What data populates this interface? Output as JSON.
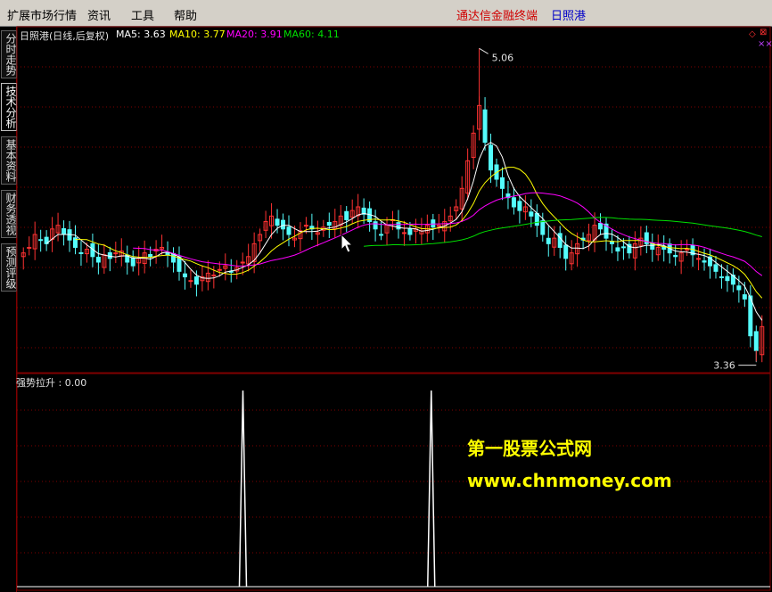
{
  "menu": {
    "items": [
      "扩展市场行情",
      "资讯",
      "工具",
      "帮助"
    ],
    "title_red": "通达信金融终端",
    "title_blue": "日照港"
  },
  "sidebar": {
    "tabs": [
      "分时走势",
      "技术分析",
      "基本资料",
      "财务透视",
      "预测评级"
    ],
    "active_index": 1
  },
  "main_chart": {
    "title": "日照港(日线,后复权)",
    "ma5_label": "MA5: 3.63",
    "ma10_label": "MA10: 3.77",
    "ma20_label": "MA20: 3.91",
    "ma60_label": "MA60: 4.11",
    "high_label": "5.06",
    "low_label": "3.36",
    "colors": {
      "up": "#ff3232",
      "down": "#54fcfc",
      "ma5": "#ffffff",
      "ma10": "#ffff00",
      "ma20": "#ff00ff",
      "ma60": "#00e000",
      "grid": "#800000"
    }
  },
  "indicator": {
    "label": "强势拉升 : 0.00"
  },
  "watermark": {
    "line1": "第一股票公式网",
    "line2": "www.chnmoney.com"
  },
  "chart_data": {
    "type": "line",
    "close": [
      3.95,
      3.98,
      4.05,
      4.02,
      4.0,
      4.08,
      4.1,
      4.05,
      4.02,
      3.98,
      3.95,
      3.97,
      3.93,
      3.9,
      3.94,
      3.92,
      3.95,
      3.96,
      3.9,
      3.88,
      3.92,
      3.95,
      3.93,
      3.97,
      3.98,
      3.94,
      3.9,
      3.85,
      3.82,
      3.8,
      3.78,
      3.82,
      3.84,
      3.83,
      3.86,
      3.88,
      3.85,
      3.87,
      3.9,
      3.93,
      4.0,
      4.05,
      4.12,
      4.15,
      4.1,
      4.08,
      4.05,
      4.03,
      4.07,
      4.1,
      4.08,
      4.06,
      4.09,
      4.1,
      4.12,
      4.15,
      4.13,
      4.18,
      4.2,
      4.16,
      4.12,
      4.08,
      4.05,
      4.1,
      4.13,
      4.08,
      4.06,
      4.05,
      4.08,
      4.07,
      4.1,
      4.09,
      4.1,
      4.12,
      4.15,
      4.2,
      4.3,
      4.45,
      4.6,
      4.75,
      4.55,
      4.4,
      4.35,
      4.3,
      4.25,
      4.2,
      4.18,
      4.2,
      4.15,
      4.1,
      4.05,
      4.0,
      4.03,
      3.98,
      3.92,
      3.95,
      4.0,
      4.02,
      4.05,
      4.1,
      4.08,
      4.03,
      4.0,
      3.96,
      3.98,
      3.95,
      4.0,
      4.03,
      4.0,
      3.97,
      3.98,
      3.97,
      3.95,
      3.93,
      3.95,
      3.97,
      3.94,
      3.92,
      3.9,
      3.88,
      3.85,
      3.82,
      3.8,
      3.78,
      3.75,
      3.7,
      3.5,
      3.42,
      3.55
    ],
    "ma_latest": {
      "MA5": 3.63,
      "MA10": 3.77,
      "MA20": 3.91,
      "MA60": 4.11
    },
    "high": 5.06,
    "low": 3.36,
    "indicator_spikes": [
      0.3,
      0.55
    ],
    "indicator_value": 0.0
  }
}
